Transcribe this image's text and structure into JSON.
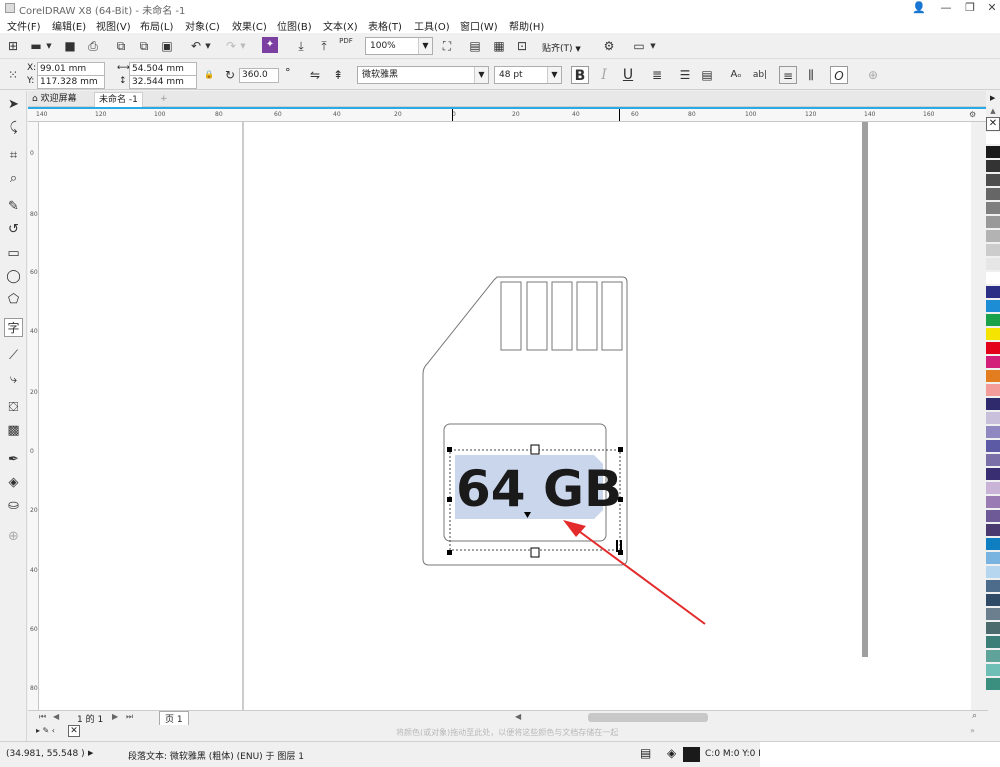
{
  "window": {
    "title": "CorelDRAW X8 (64-Bit) - 未命名 -1"
  },
  "menu": [
    "文件(F)",
    "编辑(E)",
    "视图(V)",
    "布局(L)",
    "对象(C)",
    "效果(C)",
    "位图(B)",
    "文本(X)",
    "表格(T)",
    "工具(O)",
    "窗口(W)",
    "帮助(H)"
  ],
  "standard_toolbar": {
    "zoom": "100%",
    "snap_label": "贴齐(T)",
    "pdf_label": "PDF"
  },
  "property_bar": {
    "x_label": "X:",
    "x_value": "99.01 mm",
    "y_label": "Y:",
    "y_value": "117.328 mm",
    "width_value": "54.504 mm",
    "height_value": "32.544 mm",
    "rotation_value": "360.0",
    "degree_symbol": "°",
    "font_name": "微软雅黑",
    "font_size": "48 pt",
    "btn_bold": "B",
    "btn_italic": "I",
    "btn_underline": "U",
    "btn_caps": "Aₒ",
    "btn_abl": "ab|",
    "btn_oblique": "O"
  },
  "doc_tabs": {
    "welcome": "欢迎屏幕",
    "doc": "未命名 -1"
  },
  "ruler": {
    "h_labels": [
      "140",
      "120",
      "100",
      "80",
      "60",
      "40",
      "20",
      "0",
      "20",
      "40",
      "60",
      "80",
      "100",
      "120",
      "140",
      "160"
    ],
    "v_labels": [
      "0",
      "80",
      "60",
      "40",
      "20",
      "0",
      "20",
      "40",
      "60",
      "80"
    ]
  },
  "canvas": {
    "card_text": "64 GB",
    "arrow_color": "#e32b2b",
    "selection_highlight": "#c9d6ec"
  },
  "page_nav": {
    "page_count_text": "1 的 1",
    "page_tab": "页 1",
    "hint": "将颜色(或对象)拖动至此处，以便将这些颜色与文档存储在一起"
  },
  "status": {
    "coords": "(34.981, 55.548 )",
    "info": "段落文本: 微软雅黑 (粗体) (ENU) 于 图层 1",
    "fill_info": "C:0 M:0 Y:0 K:1..."
  },
  "palette": [
    "#ffffff",
    "#1a1a1a",
    "#333333",
    "#4d4d4d",
    "#666666",
    "#808080",
    "#999999",
    "#b3b3b3",
    "#cccccc",
    "#e6e6e6",
    "#ffffff",
    "#2b2f86",
    "#1d8dd6",
    "#1aa24a",
    "#f5e400",
    "#e3001b",
    "#d31f79",
    "#e27e1f",
    "#f39c9a",
    "#2e2a6b",
    "#c9c0dc",
    "#8f88c1",
    "#5c5aa4",
    "#7b6fa8",
    "#3a2e73",
    "#c9b3d6",
    "#9b7bb3",
    "#6e5a96",
    "#4a3a70",
    "#0f7fc2",
    "#79b3e0",
    "#b6d5ef",
    "#4d6b8a",
    "#2e4a66",
    "#6b7f8f",
    "#4c6b6e",
    "#3c7f78",
    "#5fa39b",
    "#6fbfb6",
    "#3a8f7e"
  ],
  "colors": {
    "accent": "#29a9e6",
    "ui_bg": "#f0f0f0"
  }
}
